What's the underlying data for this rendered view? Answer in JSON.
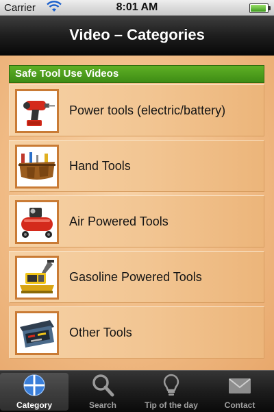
{
  "status_bar": {
    "carrier": "Carrier",
    "time": "8:01 AM"
  },
  "nav": {
    "title": "Video – Categories"
  },
  "section": {
    "header": "Safe Tool Use Videos"
  },
  "categories": [
    {
      "label": "Power tools (electric/battery)",
      "icon": "cordless-drill-icon"
    },
    {
      "label": "Hand Tools",
      "icon": "tool-belt-icon"
    },
    {
      "label": "Air Powered Tools",
      "icon": "air-compressor-icon"
    },
    {
      "label": "Gasoline Powered Tools",
      "icon": "plate-compactor-icon"
    },
    {
      "label": "Other Tools",
      "icon": "toolbox-icon"
    }
  ],
  "tabs": [
    {
      "label": "Category",
      "icon": "globe-icon",
      "active": true
    },
    {
      "label": "Search",
      "icon": "magnifier-icon",
      "active": false
    },
    {
      "label": "Tip of the day",
      "icon": "lightbulb-icon",
      "active": false
    },
    {
      "label": "Contact",
      "icon": "envelope-icon",
      "active": false
    }
  ],
  "colors": {
    "section_header": "#4c9e1c",
    "thumb_border": "#c97b35",
    "tab_active_icon": "#3b7fd9"
  }
}
